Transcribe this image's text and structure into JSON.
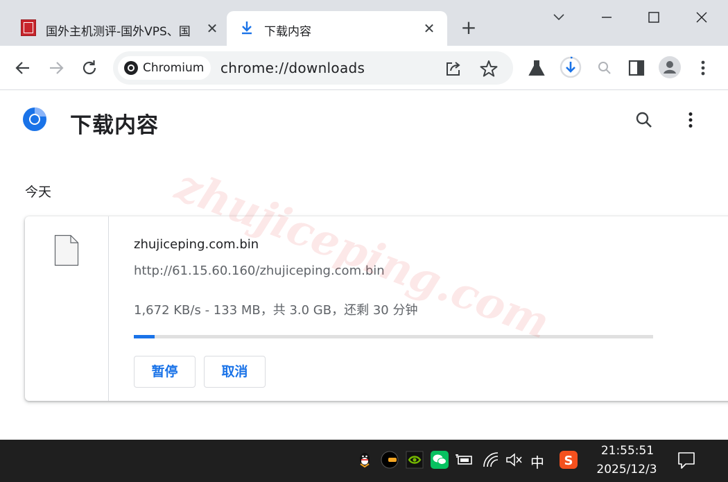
{
  "tabs": [
    {
      "title": "国外主机测评-国外VPS、国",
      "close": "✕"
    },
    {
      "title": "下载内容",
      "close": "✕"
    }
  ],
  "new_tab": "+",
  "omnibox": {
    "chip": "Chromium",
    "url": "chrome://downloads"
  },
  "page": {
    "title": "下载内容",
    "section": "今天"
  },
  "download": {
    "file_name": "zhujiceping.com.bin",
    "url": "http://61.15.60.160/zhujiceping.com.bin",
    "status": "1,672 KB/s - 133 MB，共 3.0 GB，还剩 30 分钟",
    "progress": 0.04,
    "pause_label": "暂停",
    "cancel_label": "取消"
  },
  "watermark": "zhujiceping.com",
  "taskbar": {
    "ime": "中",
    "time": "21:55:51",
    "date": "2025/12/3"
  },
  "colors": {
    "accent": "#1a73e8",
    "tabstrip": "#dee1e6",
    "taskbar": "#1f1f1f",
    "watermark": "#eb5050"
  }
}
